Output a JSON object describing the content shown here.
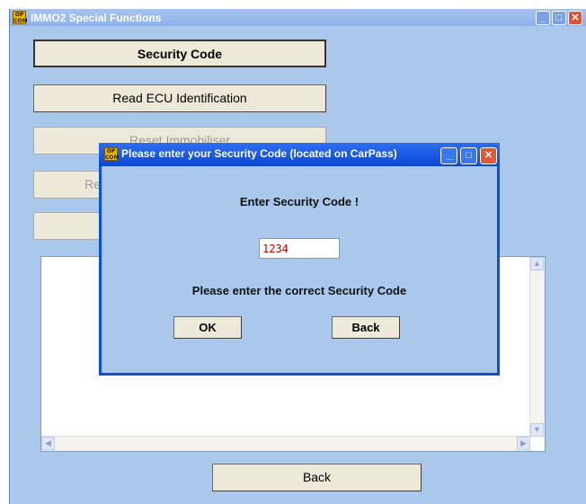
{
  "main_window": {
    "icon_text": "OP COM",
    "title": "IMMO2 Special Functions",
    "buttons": {
      "security_code": "Security Code",
      "read_ecu": "Read ECU Identification",
      "reset_immobiliser": "Reset Immobiliser",
      "fourth_partial": "Re",
      "back": "Back"
    }
  },
  "dialog": {
    "icon_text": "OP COM",
    "title": "Please enter your Security Code (located on CarPass)",
    "heading": "Enter Security Code !",
    "code_value": "1234",
    "hint": "Please enter the correct Security Code",
    "ok_label": "OK",
    "back_label": "Back"
  },
  "icons": {
    "minimize": "minimize-icon",
    "maximize": "maximize-icon",
    "close": "close-icon"
  },
  "colors": {
    "window_bg": "#a9c8ec",
    "dialog_frame": "#0f4fd6",
    "code_text": "#c00000"
  }
}
